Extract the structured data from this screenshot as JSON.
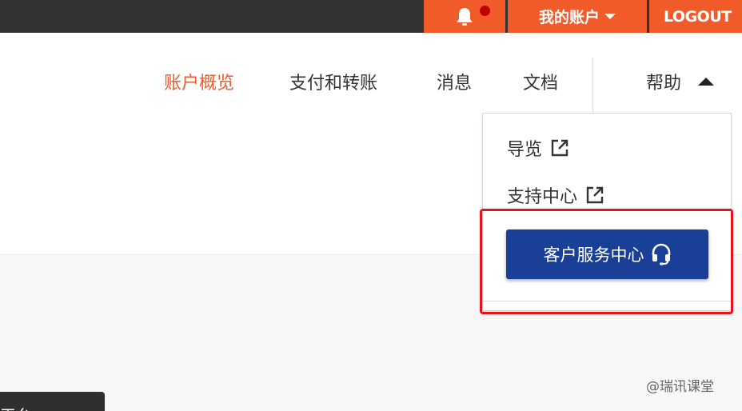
{
  "topbar": {
    "account_label": "我的账户",
    "logout_label": "LOGOUT"
  },
  "nav": {
    "items": [
      {
        "label": "账户概览",
        "active": true
      },
      {
        "label": "支付和转账",
        "active": false
      },
      {
        "label": "消息",
        "active": false
      },
      {
        "label": "文档",
        "active": false
      }
    ],
    "help_label": "帮助"
  },
  "help_menu": {
    "items": [
      {
        "label": "导览",
        "icon": "external-link-icon"
      },
      {
        "label": "支持中心",
        "icon": "external-link-icon"
      }
    ],
    "customer_service_label": "客户服务中心",
    "customer_service_icon": "headset-icon"
  },
  "tooltip": {
    "text": "平台"
  },
  "watermark": {
    "text": "@瑞讯课堂"
  },
  "colors": {
    "accent": "#f15a29",
    "topbar_bg": "#333333",
    "primary_button": "#1a3f96",
    "highlight": "#e8141b",
    "notification_dot": "#c00000"
  }
}
